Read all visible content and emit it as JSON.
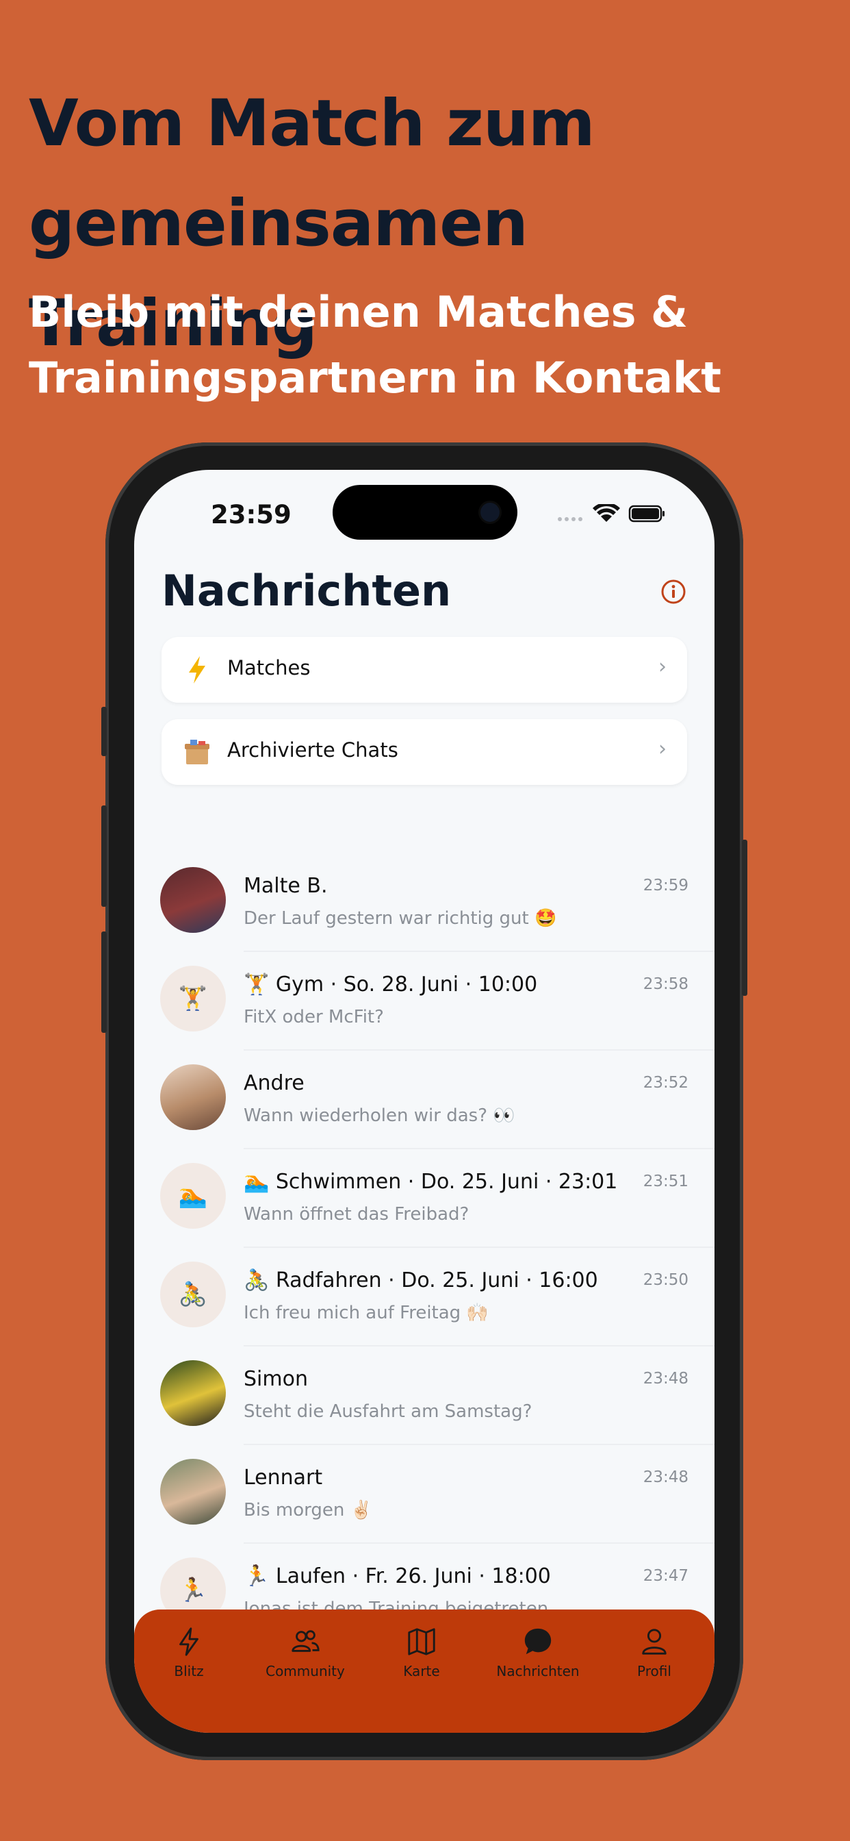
{
  "headline": "Vom Match zum gemeinsamen Training",
  "subline": "Bleib mit deinen Matches & Trainingspartnern in Kontakt",
  "status_bar": {
    "time": "23:59"
  },
  "page_title": "Nachrichten",
  "cards": [
    {
      "label": "Matches",
      "icon": "lightning-icon"
    },
    {
      "label": "Archivierte Chats",
      "icon": "archive-box-icon"
    }
  ],
  "chats": [
    {
      "name": "Malte B.",
      "preview": "Der Lauf gestern war richtig gut 🤩",
      "time": "23:59",
      "avatar": "photo",
      "avatar_emoji": ""
    },
    {
      "name": "🏋️ Gym · So. 28. Juni · 10:00",
      "preview": "FitX oder McFit?",
      "time": "23:58",
      "avatar": "emoji",
      "avatar_emoji": "🏋️"
    },
    {
      "name": "Andre",
      "preview": "Wann wiederholen wir das? 👀",
      "time": "23:52",
      "avatar": "photo",
      "avatar_emoji": ""
    },
    {
      "name": "🏊 Schwimmen · Do. 25. Juni · 23:01",
      "preview": "Wann öffnet das Freibad?",
      "time": "23:51",
      "avatar": "emoji",
      "avatar_emoji": "🏊"
    },
    {
      "name": "🚴 Radfahren · Do. 25. Juni · 16:00",
      "preview": "Ich freu mich auf Freitag 🙌🏻",
      "time": "23:50",
      "avatar": "emoji",
      "avatar_emoji": "🚴"
    },
    {
      "name": "Simon",
      "preview": "Steht die Ausfahrt am Samstag?",
      "time": "23:48",
      "avatar": "photo",
      "avatar_emoji": ""
    },
    {
      "name": "Lennart",
      "preview": "Bis morgen ✌🏻",
      "time": "23:48",
      "avatar": "photo",
      "avatar_emoji": ""
    },
    {
      "name": "🏃 Laufen · Fr. 26. Juni · 18:00",
      "preview": "Jonas ist dem Training beigetreten",
      "time": "23:47",
      "avatar": "emoji",
      "avatar_emoji": "🏃"
    }
  ],
  "tabs": [
    {
      "label": "Blitz",
      "icon": "lightning-icon"
    },
    {
      "label": "Community",
      "icon": "people-icon"
    },
    {
      "label": "Karte",
      "icon": "map-icon"
    },
    {
      "label": "Nachrichten",
      "icon": "chat-bubble-icon",
      "active": true
    },
    {
      "label": "Profil",
      "icon": "person-icon"
    }
  ],
  "colors": {
    "background": "#CF6236",
    "headline": "#0F1B2C",
    "tabbar": "#BE3A0A",
    "accent": "#C0431A"
  }
}
